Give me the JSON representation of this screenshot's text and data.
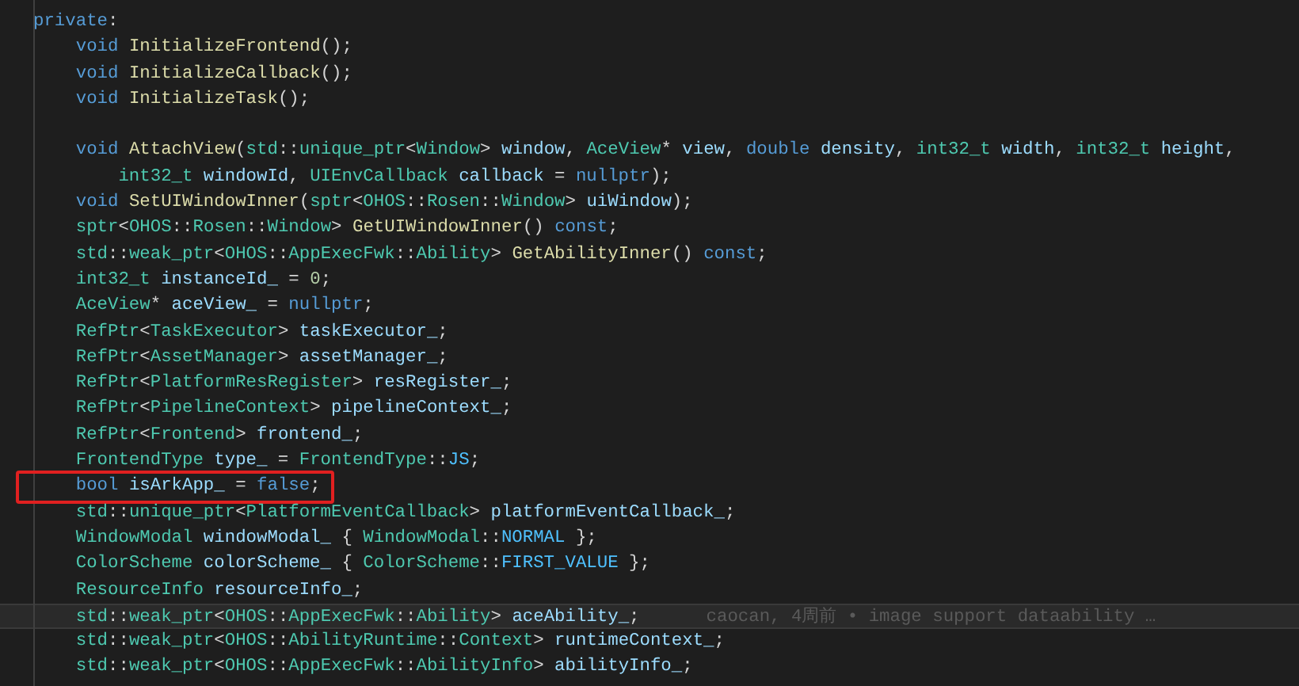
{
  "editor": {
    "lines": [
      {
        "kind": "code",
        "boxed": false,
        "current": false,
        "tokens": [
          {
            "text": "private",
            "kind": "kw"
          },
          {
            "text": ":",
            "kind": "p"
          }
        ]
      },
      {
        "kind": "code",
        "boxed": false,
        "current": false,
        "tokens": [
          {
            "text": "    void ",
            "kind": "kw"
          },
          {
            "text": "InitializeFrontend",
            "kind": "fn"
          },
          {
            "text": "();",
            "kind": "p"
          }
        ]
      },
      {
        "kind": "code",
        "boxed": false,
        "current": false,
        "tokens": [
          {
            "text": "    void ",
            "kind": "kw"
          },
          {
            "text": "InitializeCallback",
            "kind": "fn"
          },
          {
            "text": "();",
            "kind": "p"
          }
        ]
      },
      {
        "kind": "code",
        "boxed": false,
        "current": false,
        "tokens": [
          {
            "text": "    void ",
            "kind": "kw"
          },
          {
            "text": "InitializeTask",
            "kind": "fn"
          },
          {
            "text": "();",
            "kind": "p"
          }
        ]
      },
      {
        "kind": "blank",
        "boxed": false,
        "current": false
      },
      {
        "kind": "code",
        "boxed": false,
        "current": false,
        "tokens": [
          {
            "text": "    void ",
            "kind": "kw"
          },
          {
            "text": "AttachView",
            "kind": "fn"
          },
          {
            "text": "(",
            "kind": "p"
          },
          {
            "text": "std",
            "kind": "type"
          },
          {
            "text": "::",
            "kind": "p"
          },
          {
            "text": "unique_ptr",
            "kind": "type"
          },
          {
            "text": "<",
            "kind": "p"
          },
          {
            "text": "Window",
            "kind": "type"
          },
          {
            "text": "> ",
            "kind": "p"
          },
          {
            "text": "window",
            "kind": "var"
          },
          {
            "text": ", ",
            "kind": "p"
          },
          {
            "text": "AceView",
            "kind": "type"
          },
          {
            "text": "* ",
            "kind": "p"
          },
          {
            "text": "view",
            "kind": "var"
          },
          {
            "text": ", ",
            "kind": "p"
          },
          {
            "text": "double ",
            "kind": "kw"
          },
          {
            "text": "density",
            "kind": "var"
          },
          {
            "text": ", ",
            "kind": "p"
          },
          {
            "text": "int32_t ",
            "kind": "type"
          },
          {
            "text": "width",
            "kind": "var"
          },
          {
            "text": ", ",
            "kind": "p"
          },
          {
            "text": "int32_t ",
            "kind": "type"
          },
          {
            "text": "height",
            "kind": "var"
          },
          {
            "text": ",",
            "kind": "p"
          }
        ]
      },
      {
        "kind": "code",
        "boxed": false,
        "current": false,
        "tokens": [
          {
            "text": "        int32_t ",
            "kind": "type"
          },
          {
            "text": "windowId",
            "kind": "var"
          },
          {
            "text": ", ",
            "kind": "p"
          },
          {
            "text": "UIEnvCallback ",
            "kind": "type"
          },
          {
            "text": "callback",
            "kind": "var"
          },
          {
            "text": " = ",
            "kind": "p"
          },
          {
            "text": "nullptr",
            "kind": "kw"
          },
          {
            "text": ");",
            "kind": "p"
          }
        ]
      },
      {
        "kind": "code",
        "boxed": false,
        "current": false,
        "tokens": [
          {
            "text": "    void ",
            "kind": "kw"
          },
          {
            "text": "SetUIWindowInner",
            "kind": "fn"
          },
          {
            "text": "(",
            "kind": "p"
          },
          {
            "text": "sptr",
            "kind": "type"
          },
          {
            "text": "<",
            "kind": "p"
          },
          {
            "text": "OHOS",
            "kind": "type"
          },
          {
            "text": "::",
            "kind": "p"
          },
          {
            "text": "Rosen",
            "kind": "type"
          },
          {
            "text": "::",
            "kind": "p"
          },
          {
            "text": "Window",
            "kind": "type"
          },
          {
            "text": "> ",
            "kind": "p"
          },
          {
            "text": "uiWindow",
            "kind": "var"
          },
          {
            "text": ");",
            "kind": "p"
          }
        ]
      },
      {
        "kind": "code",
        "boxed": false,
        "current": false,
        "tokens": [
          {
            "text": "    sptr",
            "kind": "type"
          },
          {
            "text": "<",
            "kind": "p"
          },
          {
            "text": "OHOS",
            "kind": "type"
          },
          {
            "text": "::",
            "kind": "p"
          },
          {
            "text": "Rosen",
            "kind": "type"
          },
          {
            "text": "::",
            "kind": "p"
          },
          {
            "text": "Window",
            "kind": "type"
          },
          {
            "text": "> ",
            "kind": "p"
          },
          {
            "text": "GetUIWindowInner",
            "kind": "fn"
          },
          {
            "text": "() ",
            "kind": "p"
          },
          {
            "text": "const",
            "kind": "kw"
          },
          {
            "text": ";",
            "kind": "p"
          }
        ]
      },
      {
        "kind": "code",
        "boxed": false,
        "current": false,
        "tokens": [
          {
            "text": "    std",
            "kind": "type"
          },
          {
            "text": "::",
            "kind": "p"
          },
          {
            "text": "weak_ptr",
            "kind": "type"
          },
          {
            "text": "<",
            "kind": "p"
          },
          {
            "text": "OHOS",
            "kind": "type"
          },
          {
            "text": "::",
            "kind": "p"
          },
          {
            "text": "AppExecFwk",
            "kind": "type"
          },
          {
            "text": "::",
            "kind": "p"
          },
          {
            "text": "Ability",
            "kind": "type"
          },
          {
            "text": "> ",
            "kind": "p"
          },
          {
            "text": "GetAbilityInner",
            "kind": "fn"
          },
          {
            "text": "() ",
            "kind": "p"
          },
          {
            "text": "const",
            "kind": "kw"
          },
          {
            "text": ";",
            "kind": "p"
          }
        ]
      },
      {
        "kind": "code",
        "boxed": false,
        "current": false,
        "tokens": [
          {
            "text": "    int32_t ",
            "kind": "type"
          },
          {
            "text": "instanceId_",
            "kind": "var"
          },
          {
            "text": " = ",
            "kind": "p"
          },
          {
            "text": "0",
            "kind": "num"
          },
          {
            "text": ";",
            "kind": "p"
          }
        ]
      },
      {
        "kind": "code",
        "boxed": false,
        "current": false,
        "tokens": [
          {
            "text": "    AceView",
            "kind": "type"
          },
          {
            "text": "* ",
            "kind": "p"
          },
          {
            "text": "aceView_",
            "kind": "var"
          },
          {
            "text": " = ",
            "kind": "p"
          },
          {
            "text": "nullptr",
            "kind": "kw"
          },
          {
            "text": ";",
            "kind": "p"
          }
        ]
      },
      {
        "kind": "code",
        "boxed": false,
        "current": false,
        "tokens": [
          {
            "text": "    RefPtr",
            "kind": "type"
          },
          {
            "text": "<",
            "kind": "p"
          },
          {
            "text": "TaskExecutor",
            "kind": "type"
          },
          {
            "text": "> ",
            "kind": "p"
          },
          {
            "text": "taskExecutor_",
            "kind": "var"
          },
          {
            "text": ";",
            "kind": "p"
          }
        ]
      },
      {
        "kind": "code",
        "boxed": false,
        "current": false,
        "tokens": [
          {
            "text": "    RefPtr",
            "kind": "type"
          },
          {
            "text": "<",
            "kind": "p"
          },
          {
            "text": "AssetManager",
            "kind": "type"
          },
          {
            "text": "> ",
            "kind": "p"
          },
          {
            "text": "assetManager_",
            "kind": "var"
          },
          {
            "text": ";",
            "kind": "p"
          }
        ]
      },
      {
        "kind": "code",
        "boxed": false,
        "current": false,
        "tokens": [
          {
            "text": "    RefPtr",
            "kind": "type"
          },
          {
            "text": "<",
            "kind": "p"
          },
          {
            "text": "PlatformResRegister",
            "kind": "type"
          },
          {
            "text": "> ",
            "kind": "p"
          },
          {
            "text": "resRegister_",
            "kind": "var"
          },
          {
            "text": ";",
            "kind": "p"
          }
        ]
      },
      {
        "kind": "code",
        "boxed": false,
        "current": false,
        "tokens": [
          {
            "text": "    RefPtr",
            "kind": "type"
          },
          {
            "text": "<",
            "kind": "p"
          },
          {
            "text": "PipelineContext",
            "kind": "type"
          },
          {
            "text": "> ",
            "kind": "p"
          },
          {
            "text": "pipelineContext_",
            "kind": "var"
          },
          {
            "text": ";",
            "kind": "p"
          }
        ]
      },
      {
        "kind": "code",
        "boxed": false,
        "current": false,
        "tokens": [
          {
            "text": "    RefPtr",
            "kind": "type"
          },
          {
            "text": "<",
            "kind": "p"
          },
          {
            "text": "Frontend",
            "kind": "type"
          },
          {
            "text": "> ",
            "kind": "p"
          },
          {
            "text": "frontend_",
            "kind": "var"
          },
          {
            "text": ";",
            "kind": "p"
          }
        ]
      },
      {
        "kind": "code",
        "boxed": false,
        "current": false,
        "tokens": [
          {
            "text": "    FrontendType ",
            "kind": "type"
          },
          {
            "text": "type_",
            "kind": "var"
          },
          {
            "text": " = ",
            "kind": "p"
          },
          {
            "text": "FrontendType",
            "kind": "type"
          },
          {
            "text": "::",
            "kind": "p"
          },
          {
            "text": "JS",
            "kind": "enum"
          },
          {
            "text": ";",
            "kind": "p"
          }
        ]
      },
      {
        "kind": "code",
        "boxed": true,
        "current": false,
        "tokens": [
          {
            "text": "    bool ",
            "kind": "kw"
          },
          {
            "text": "isArkApp_",
            "kind": "var"
          },
          {
            "text": " = ",
            "kind": "p"
          },
          {
            "text": "false",
            "kind": "kw"
          },
          {
            "text": ";",
            "kind": "p"
          }
        ]
      },
      {
        "kind": "code",
        "boxed": false,
        "current": false,
        "tokens": [
          {
            "text": "    std",
            "kind": "type"
          },
          {
            "text": "::",
            "kind": "p"
          },
          {
            "text": "unique_ptr",
            "kind": "type"
          },
          {
            "text": "<",
            "kind": "p"
          },
          {
            "text": "PlatformEventCallback",
            "kind": "type"
          },
          {
            "text": "> ",
            "kind": "p"
          },
          {
            "text": "platformEventCallback_",
            "kind": "var"
          },
          {
            "text": ";",
            "kind": "p"
          }
        ]
      },
      {
        "kind": "code",
        "boxed": false,
        "current": false,
        "tokens": [
          {
            "text": "    WindowModal ",
            "kind": "type"
          },
          {
            "text": "windowModal_",
            "kind": "var"
          },
          {
            "text": " { ",
            "kind": "p"
          },
          {
            "text": "WindowModal",
            "kind": "type"
          },
          {
            "text": "::",
            "kind": "p"
          },
          {
            "text": "NORMAL",
            "kind": "enum"
          },
          {
            "text": " };",
            "kind": "p"
          }
        ]
      },
      {
        "kind": "code",
        "boxed": false,
        "current": false,
        "tokens": [
          {
            "text": "    ColorScheme ",
            "kind": "type"
          },
          {
            "text": "colorScheme_",
            "kind": "var"
          },
          {
            "text": " { ",
            "kind": "p"
          },
          {
            "text": "ColorScheme",
            "kind": "type"
          },
          {
            "text": "::",
            "kind": "p"
          },
          {
            "text": "FIRST_VALUE",
            "kind": "enum"
          },
          {
            "text": " };",
            "kind": "p"
          }
        ]
      },
      {
        "kind": "code",
        "boxed": false,
        "current": false,
        "tokens": [
          {
            "text": "    ResourceInfo ",
            "kind": "type"
          },
          {
            "text": "resourceInfo_",
            "kind": "var"
          },
          {
            "text": ";",
            "kind": "p"
          }
        ]
      },
      {
        "kind": "code",
        "boxed": false,
        "current": true,
        "blame": "caocan, 4周前 • image support dataability …",
        "tokens": [
          {
            "text": "    std",
            "kind": "type"
          },
          {
            "text": "::",
            "kind": "p"
          },
          {
            "text": "weak_ptr",
            "kind": "type"
          },
          {
            "text": "<",
            "kind": "p"
          },
          {
            "text": "OHOS",
            "kind": "type"
          },
          {
            "text": "::",
            "kind": "p"
          },
          {
            "text": "AppExecFwk",
            "kind": "type"
          },
          {
            "text": "::",
            "kind": "p"
          },
          {
            "text": "Ability",
            "kind": "type"
          },
          {
            "text": "> ",
            "kind": "p"
          },
          {
            "text": "aceAbility_",
            "kind": "var"
          },
          {
            "text": ";",
            "kind": "p"
          }
        ]
      },
      {
        "kind": "code",
        "boxed": false,
        "current": false,
        "tokens": [
          {
            "text": "    std",
            "kind": "type"
          },
          {
            "text": "::",
            "kind": "p"
          },
          {
            "text": "weak_ptr",
            "kind": "type"
          },
          {
            "text": "<",
            "kind": "p"
          },
          {
            "text": "OHOS",
            "kind": "type"
          },
          {
            "text": "::",
            "kind": "p"
          },
          {
            "text": "AbilityRuntime",
            "kind": "type"
          },
          {
            "text": "::",
            "kind": "p"
          },
          {
            "text": "Context",
            "kind": "type"
          },
          {
            "text": "> ",
            "kind": "p"
          },
          {
            "text": "runtimeContext_",
            "kind": "var"
          },
          {
            "text": ";",
            "kind": "p"
          }
        ]
      },
      {
        "kind": "code",
        "boxed": false,
        "current": false,
        "tokens": [
          {
            "text": "    std",
            "kind": "type"
          },
          {
            "text": "::",
            "kind": "p"
          },
          {
            "text": "weak_ptr",
            "kind": "type"
          },
          {
            "text": "<",
            "kind": "p"
          },
          {
            "text": "OHOS",
            "kind": "type"
          },
          {
            "text": "::",
            "kind": "p"
          },
          {
            "text": "AppExecFwk",
            "kind": "type"
          },
          {
            "text": "::",
            "kind": "p"
          },
          {
            "text": "AbilityInfo",
            "kind": "type"
          },
          {
            "text": "> ",
            "kind": "p"
          },
          {
            "text": "abilityInfo_",
            "kind": "var"
          },
          {
            "text": ";",
            "kind": "p"
          }
        ]
      }
    ]
  }
}
